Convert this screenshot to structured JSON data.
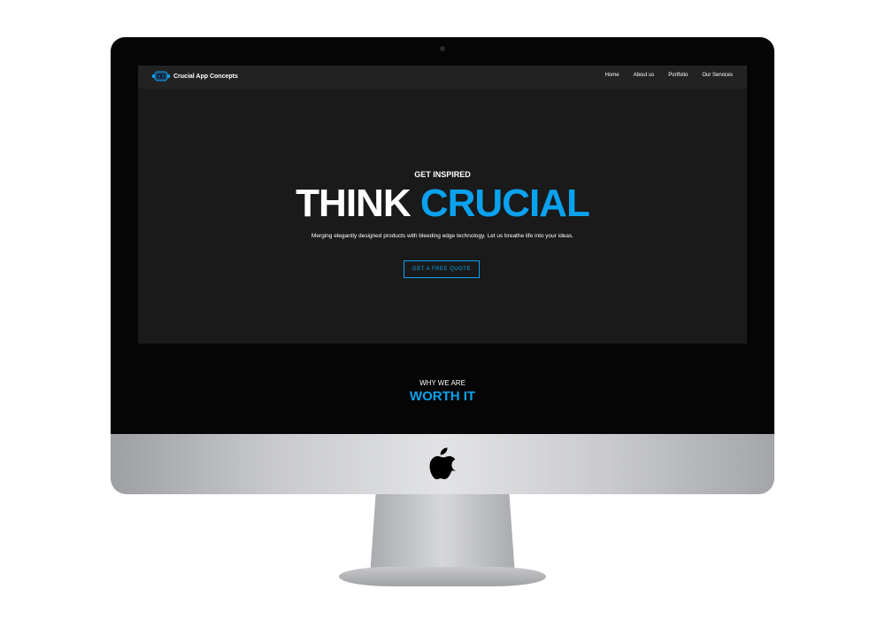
{
  "brand": {
    "name": "Crucial App Concepts",
    "accent_color": "#0aa2ee",
    "logo_icon": "robot-logo-icon"
  },
  "nav": {
    "items": [
      {
        "label": "Home"
      },
      {
        "label": "About us"
      },
      {
        "label": "Portfolio"
      },
      {
        "label": "Our Services"
      }
    ]
  },
  "hero": {
    "eyebrow": "GET INSPIRED",
    "headline_white": "THINK",
    "headline_blue": "CRUCIAL",
    "tagline": "Merging elegantly designed products with bleeding edge technology. Let us breathe life into your ideas.",
    "cta_label": "GET A FREE QUOTE"
  },
  "section": {
    "kicker": "WHY WE ARE",
    "title": "WORTH IT"
  },
  "device": {
    "logo_icon": "apple-logo-icon"
  }
}
